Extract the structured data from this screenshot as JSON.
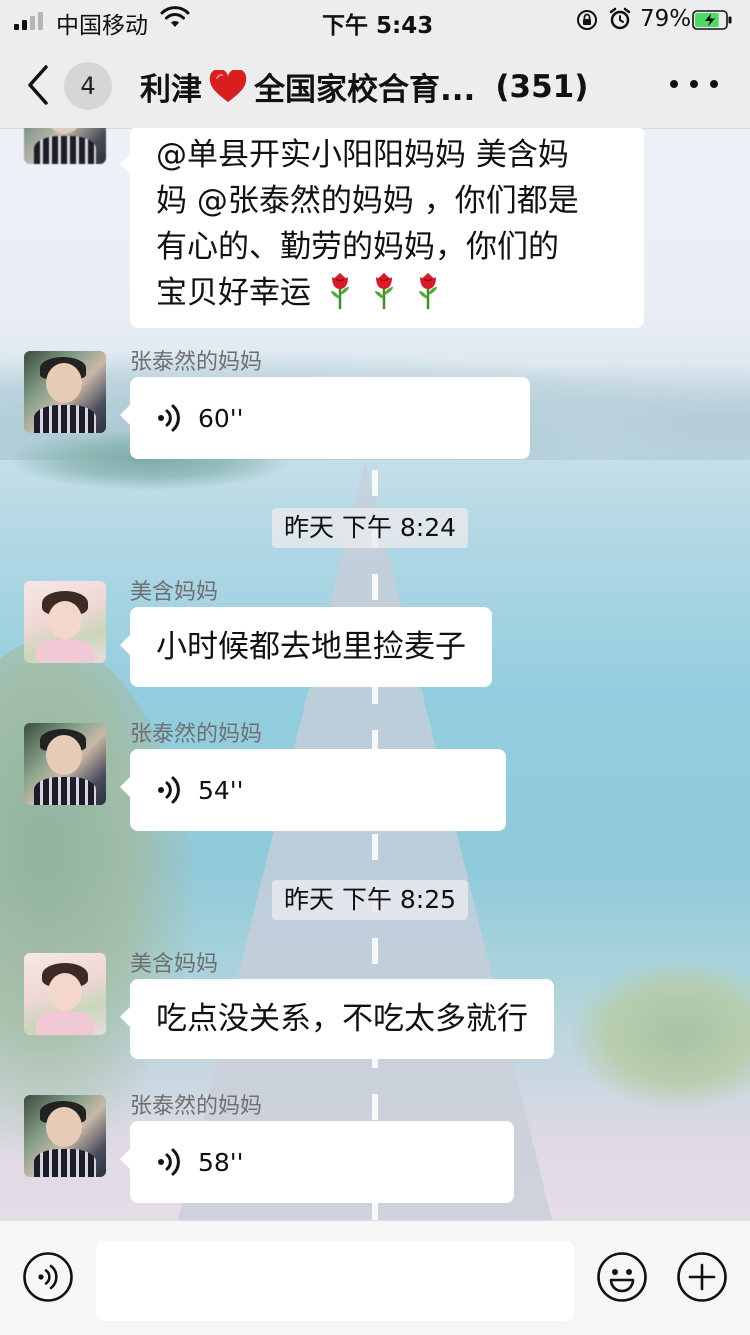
{
  "status_bar": {
    "carrier": "中国移动",
    "time": "下午 5:43",
    "battery_percent": "79%",
    "battery_level": 0.79,
    "signal_bars": 2,
    "signal_max": 4
  },
  "header": {
    "back_badge_count": "4",
    "title_prefix": "利津",
    "title_main": "全国家校合育...",
    "member_count": "(351)",
    "heart_color": "#d81e1e"
  },
  "messages": {
    "first": {
      "text_lines": [
        "@单县开实小阳阳妈妈 美含妈",
        "妈 @张泰然的妈妈 ，你们都是",
        "有心的、勤劳的妈妈，你们的",
        "宝贝好幸运"
      ],
      "rose_count": 3
    },
    "voice_1": {
      "sender": "张泰然的妈妈",
      "duration": "60''"
    },
    "time_1": "昨天 下午 8:24",
    "text_1": {
      "sender": "美含妈妈",
      "text": "小时候都去地里捡麦子"
    },
    "voice_2": {
      "sender": "张泰然的妈妈",
      "duration": "54''"
    },
    "time_2": "昨天 下午 8:25",
    "text_2": {
      "sender": "美含妈妈",
      "text": "吃点没关系，不吃太多就行"
    },
    "voice_3": {
      "sender": "张泰然的妈妈",
      "duration": "58''"
    }
  },
  "input_bar": {
    "placeholder": "",
    "voice_toggle_icon": "voice-mode-icon",
    "emoji_icon": "emoji-icon",
    "add_icon": "plus-icon"
  },
  "colors": {
    "chrome": "#ededed",
    "bubble": "#ffffff",
    "sender_name": "#6f6f72",
    "battery_fill": "#4cd964"
  }
}
